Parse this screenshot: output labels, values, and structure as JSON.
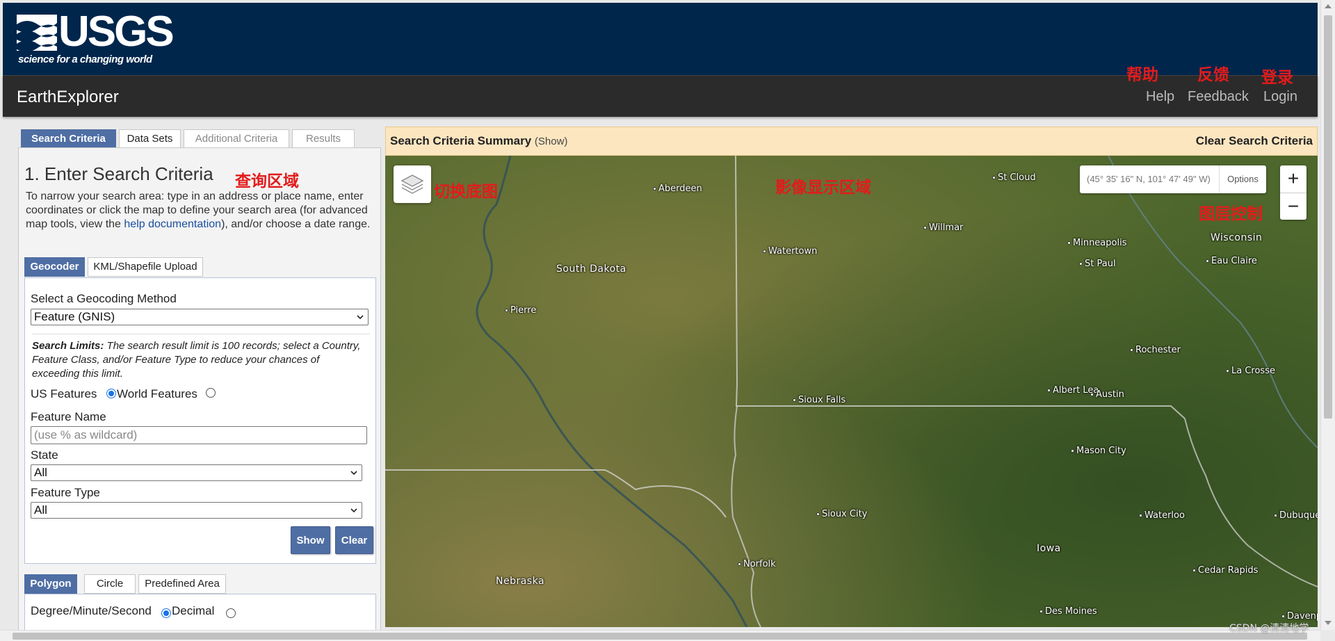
{
  "header": {
    "logo_word": "USGS",
    "logo_tagline": "science for a changing world",
    "app_title": "EarthExplorer",
    "nav": {
      "help": "Help",
      "feedback": "Feedback",
      "login": "Login"
    }
  },
  "annotations": {
    "help": "帮助",
    "feedback": "反馈",
    "login": "登录",
    "query_area": "查询区域",
    "switch_basemap": "切换底图",
    "image_display_area": "影像显示区域",
    "layer_control": "图层控制"
  },
  "left_tabs": [
    "Search Criteria",
    "Data Sets",
    "Additional Criteria",
    "Results"
  ],
  "search": {
    "title": "1. Enter Search Criteria",
    "desc_before": "To narrow your search area: type in an address or place name, enter coordinates or click the map to define your search area (for advanced map tools, view the ",
    "desc_link": "help documentation",
    "desc_after": "), and/or choose a date range.",
    "sub_tabs": [
      "Geocoder",
      "KML/Shapefile Upload"
    ],
    "geocoding_label": "Select a Geocoding Method",
    "geocoding_value": "Feature (GNIS)",
    "limits_bold": "Search Limits:",
    "limits_text": " The search result limit is 100 records; select a Country, Feature Class, and/or Feature Type to reduce your chances of exceeding this limit.",
    "us_features": "US Features",
    "world_features": "World Features",
    "feature_name_label": "Feature Name",
    "feature_name_placeholder": "(use % as wildcard)",
    "state_label": "State",
    "state_value": "All",
    "feature_type_label": "Feature Type",
    "feature_type_value": "All",
    "show_btn": "Show",
    "clear_btn": "Clear",
    "area_tabs": [
      "Polygon",
      "Circle",
      "Predefined Area"
    ],
    "dms_label": "Degree/Minute/Second",
    "decimal_label": "Decimal"
  },
  "summary": {
    "title": "Search Criteria Summary",
    "show": "(Show)",
    "clear": "Clear Search Criteria"
  },
  "map": {
    "coords": "(45° 35' 16\" N, 101° 47' 49\" W)",
    "options": "Options",
    "zoom_in": "+",
    "zoom_out": "−",
    "regions": [
      "South Dakota",
      "Nebraska",
      "Iowa",
      "Wisconsin"
    ],
    "cities": [
      "Aberdeen",
      "St Cloud",
      "Willmar",
      "Minneapolis",
      "St Paul",
      "Eau Claire",
      "Watertown",
      "Pierre",
      "Rochester",
      "La Crosse",
      "Albert Lea",
      "Austin",
      "Sioux Falls",
      "Mason City",
      "Sioux City",
      "Waterloo",
      "Dubuque",
      "Norfolk",
      "Cedar Rapids",
      "Des Moines",
      "Davenp"
    ]
  },
  "watermark": "CSDN @清清地学"
}
